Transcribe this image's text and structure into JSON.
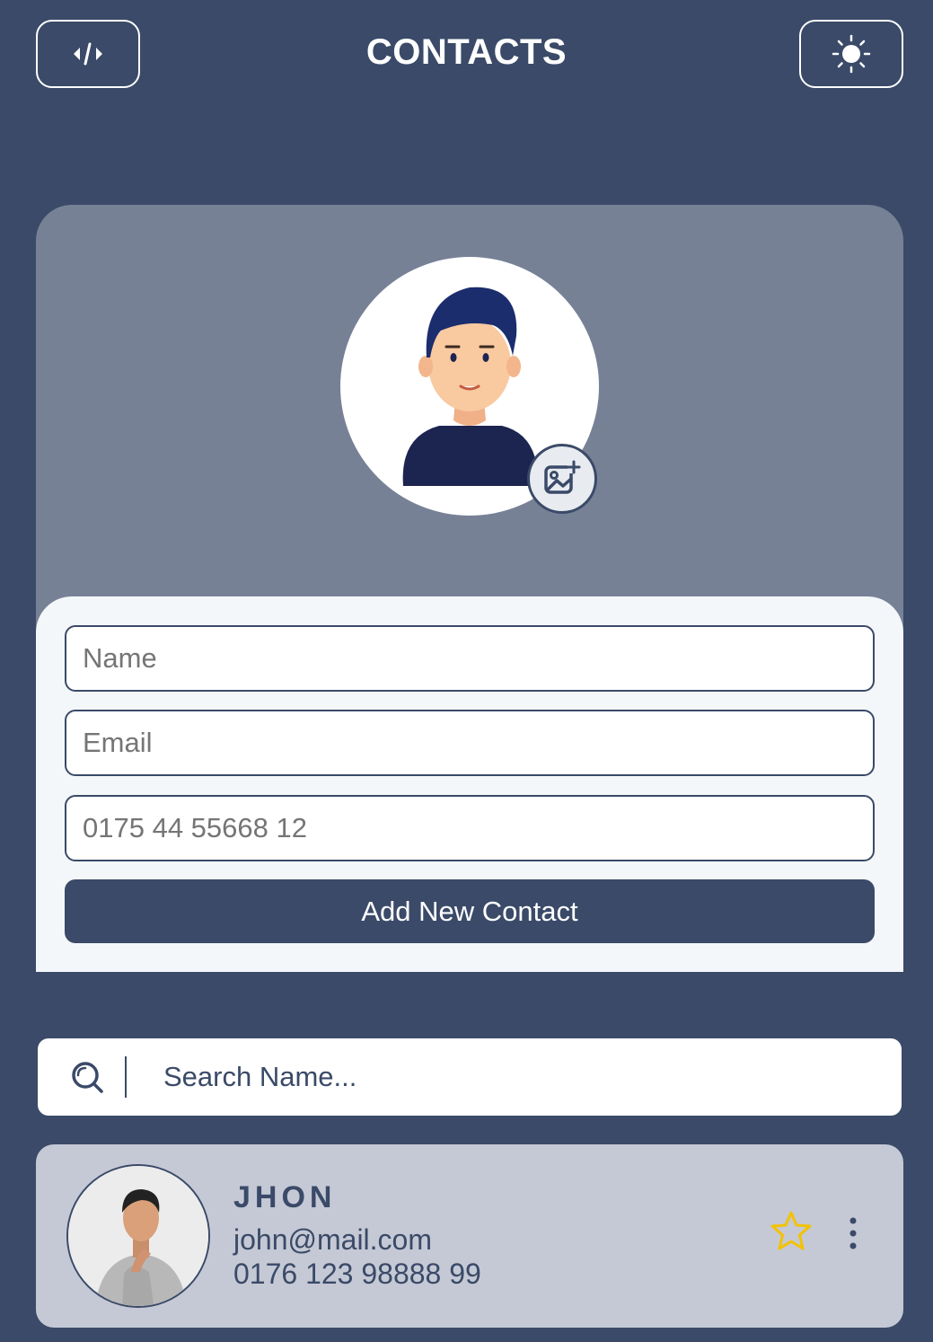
{
  "header": {
    "title": "CONTACTS",
    "left_icon": "code-icon",
    "right_icon": "sun-icon"
  },
  "profile": {
    "avatar_icon": "user-avatar-illustration",
    "upload_icon": "add-image-icon"
  },
  "form": {
    "name_placeholder": "Name",
    "email_placeholder": "Email",
    "phone_placeholder": "0175 44 55668 12",
    "submit_label": "Add New Contact"
  },
  "search": {
    "icon": "search-icon",
    "placeholder": "Search Name..."
  },
  "contacts": [
    {
      "name": "JHON",
      "email": "john@mail.com",
      "phone": "0176 123 98888 99",
      "favorite_icon": "star-outline-icon",
      "menu_icon": "more-vertical-icon"
    }
  ],
  "colors": {
    "background": "#3a4a68",
    "card_top": "#778196",
    "form_panel": "#f4f7f9",
    "contact_card": "#c5c9d5",
    "star": "#f2c200"
  }
}
